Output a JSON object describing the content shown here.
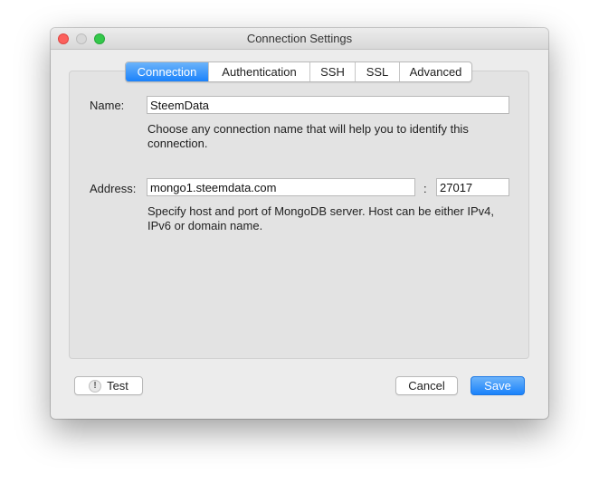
{
  "window": {
    "title": "Connection Settings"
  },
  "tabs": [
    {
      "label": "Connection",
      "active": true
    },
    {
      "label": "Authentication",
      "active": false
    },
    {
      "label": "SSH",
      "active": false
    },
    {
      "label": "SSL",
      "active": false
    },
    {
      "label": "Advanced",
      "active": false
    }
  ],
  "form": {
    "name_label": "Name:",
    "name_value": "SteemData",
    "name_help": "Choose any connection name that will help you to identify this connection.",
    "address_label": "Address:",
    "host_value": "mongo1.steemdata.com",
    "port_separator": ":",
    "port_value": "27017",
    "address_help": "Specify host and port of MongoDB server. Host can be either IPv4, IPv6 or domain name."
  },
  "buttons": {
    "test_label": "Test",
    "test_icon": "!",
    "cancel_label": "Cancel",
    "save_label": "Save"
  },
  "colors": {
    "accent": "#1a82fb",
    "close": "#fc605c",
    "maximize": "#34c84a"
  }
}
